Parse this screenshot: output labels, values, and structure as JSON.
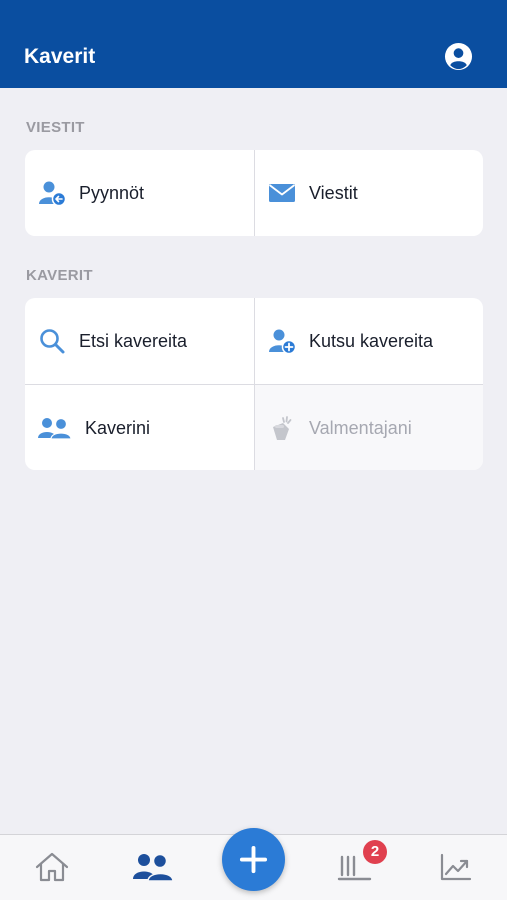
{
  "header": {
    "title": "Kaverit",
    "profile_icon": "profile-icon"
  },
  "sections": {
    "messages": {
      "title": "VIESTIT",
      "items": [
        {
          "label": "Pyynnöt",
          "icon": "friend-request-icon"
        },
        {
          "label": "Viestit",
          "icon": "mail-icon"
        }
      ]
    },
    "friends": {
      "title": "KAVERIT",
      "items": [
        {
          "label": "Etsi kavereita",
          "icon": "search-icon"
        },
        {
          "label": "Kutsu kavereita",
          "icon": "add-user-icon"
        },
        {
          "label": "Kaverini",
          "icon": "friends-icon"
        },
        {
          "label": "Valmentajani",
          "icon": "coach-icon",
          "disabled": true
        }
      ]
    }
  },
  "tabbar": {
    "items": [
      "home-icon",
      "friends-tab-icon",
      "add-icon",
      "diary-icon",
      "trend-icon"
    ],
    "badge": "2"
  },
  "colors": {
    "header": "#0a4ea0",
    "accent": "#2b7bd6",
    "icon": "#4a90d9",
    "badge": "#e0404f",
    "background": "#efeff4"
  }
}
